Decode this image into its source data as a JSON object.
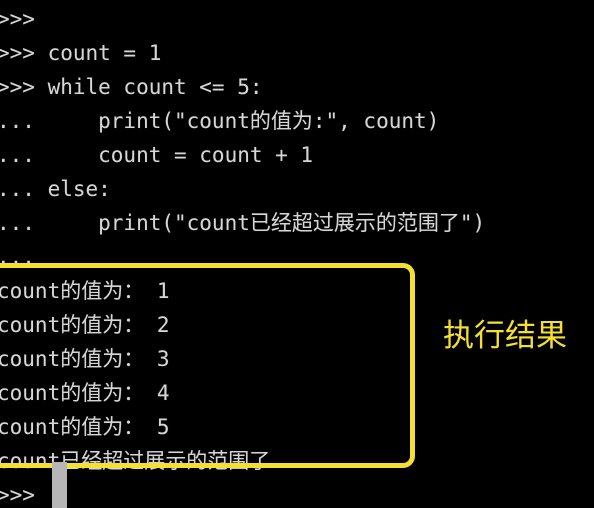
{
  "terminal": {
    "background_color": "#000000",
    "text_color": "#d6d6d6",
    "prompt": ">>>",
    "continuation_prompt": "...",
    "lines": [
      {
        "text": ">>> ",
        "kind": "prompt"
      },
      {
        "text": ">>> count = 1",
        "kind": "input"
      },
      {
        "text": ">>> while count <= 5:",
        "kind": "input"
      },
      {
        "text": "...     print(\"count的值为:\", count)",
        "kind": "input"
      },
      {
        "text": "...     count = count + 1",
        "kind": "input"
      },
      {
        "text": "... else:",
        "kind": "input"
      },
      {
        "text": "...     print(\"count已经超过展示的范围了\")",
        "kind": "input"
      },
      {
        "text": "...",
        "kind": "input"
      },
      {
        "text": "count的值为： 1",
        "kind": "output"
      },
      {
        "text": "count的值为： 2",
        "kind": "output"
      },
      {
        "text": "count的值为： 3",
        "kind": "output"
      },
      {
        "text": "count的值为： 4",
        "kind": "output"
      },
      {
        "text": "count的值为： 5",
        "kind": "output"
      },
      {
        "text": "count已经超过展示的范围了",
        "kind": "output"
      },
      {
        "text": ">>>",
        "kind": "prompt"
      }
    ]
  },
  "annotation": {
    "label": "执行结果",
    "color": "#f5e031"
  },
  "highlight_box": {
    "color": "#f5e031",
    "border_width": "5px"
  },
  "cursor": {
    "color": "#b6b6b6"
  }
}
